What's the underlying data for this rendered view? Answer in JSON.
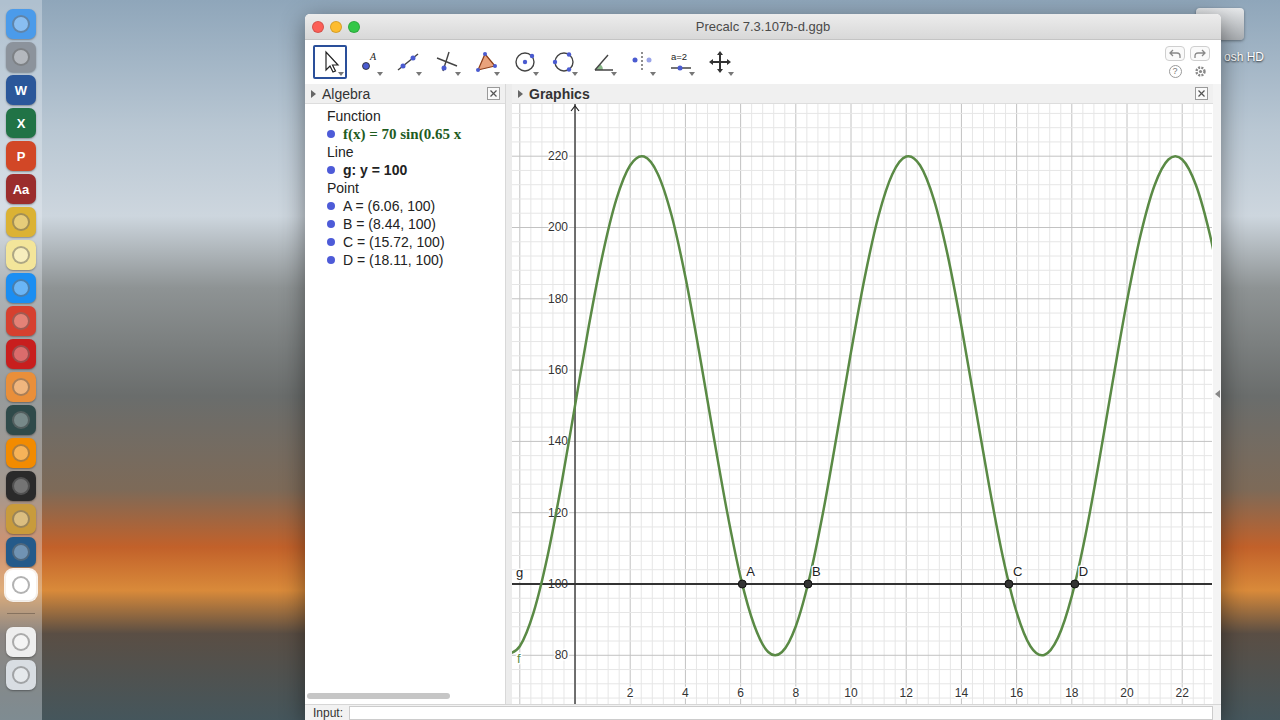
{
  "desktop": {
    "disk_label": "osh HD"
  },
  "dock": {
    "apps": [
      {
        "glyph": "",
        "color": "#4b9bea",
        "selected": false
      },
      {
        "glyph": "",
        "color": "#8c939c",
        "selected": false
      },
      {
        "glyph": "W",
        "color": "#2b579a",
        "selected": false
      },
      {
        "glyph": "X",
        "color": "#217346",
        "selected": false
      },
      {
        "glyph": "P",
        "color": "#d24726",
        "selected": false
      },
      {
        "glyph": "Aa",
        "color": "#9b2d2d",
        "selected": false
      },
      {
        "glyph": "",
        "color": "#dbb234",
        "selected": false
      },
      {
        "glyph": "",
        "color": "#f3e59a",
        "selected": false
      },
      {
        "glyph": "",
        "color": "#1b8ef2",
        "selected": false
      },
      {
        "glyph": "",
        "color": "#d6402f",
        "selected": false
      },
      {
        "glyph": "",
        "color": "#c81e1e",
        "selected": false
      },
      {
        "glyph": "",
        "color": "#e98f3a",
        "selected": false
      },
      {
        "glyph": "",
        "color": "#2f4a4a",
        "selected": false
      },
      {
        "glyph": "",
        "color": "#f28b00",
        "selected": false
      },
      {
        "glyph": "",
        "color": "#2a2a2a",
        "selected": false
      },
      {
        "glyph": "",
        "color": "#c89b3c",
        "selected": false
      },
      {
        "glyph": "",
        "color": "#245a8a",
        "selected": false
      },
      {
        "glyph": "",
        "color": "#ffffff",
        "selected": true
      }
    ],
    "others": [
      {
        "glyph": "",
        "color": "#eeeeee",
        "selected": false
      },
      {
        "glyph": "",
        "color": "#d8dde2",
        "selected": false
      }
    ]
  },
  "window": {
    "title": "Precalc 7.3.107b-d.ggb"
  },
  "toolbar": {
    "tools": [
      {
        "kind": "move",
        "label": "",
        "selected": true
      },
      {
        "kind": "point",
        "label": "A",
        "selected": false
      },
      {
        "kind": "line",
        "label": "",
        "selected": false
      },
      {
        "kind": "perpendicular",
        "label": "",
        "selected": false
      },
      {
        "kind": "polygon",
        "label": "",
        "selected": false
      },
      {
        "kind": "circle",
        "label": "",
        "selected": false
      },
      {
        "kind": "conic",
        "label": "",
        "selected": false
      },
      {
        "kind": "angle",
        "label": "",
        "selected": false
      },
      {
        "kind": "reflect",
        "label": "",
        "selected": false
      },
      {
        "kind": "slider",
        "label": "a=2",
        "selected": false
      },
      {
        "kind": "transform",
        "label": "",
        "selected": false
      }
    ],
    "help_glyph": "?"
  },
  "algebra": {
    "title": "Algebra",
    "groups": [
      {
        "label": "Function",
        "items": [
          {
            "kind": "function",
            "text": "f(x) = 70 sin(0.65 x"
          }
        ]
      },
      {
        "label": "Line",
        "items": [
          {
            "kind": "equation",
            "text": "g: y = 100"
          }
        ]
      },
      {
        "label": "Point",
        "items": [
          {
            "kind": "point",
            "text": "A = (6.06, 100)"
          },
          {
            "kind": "point",
            "text": "B = (8.44, 100)"
          },
          {
            "kind": "point",
            "text": "C = (15.72, 100)"
          },
          {
            "kind": "point",
            "text": "D = (18.11, 100)"
          }
        ]
      }
    ]
  },
  "graphics": {
    "title": "Graphics",
    "x_ticks": [
      "2",
      "4",
      "6",
      "8",
      "10",
      "12",
      "14",
      "16",
      "18",
      "20",
      "22"
    ],
    "y_ticks": [
      "80",
      "100",
      "120",
      "140",
      "160",
      "180",
      "200",
      "220"
    ],
    "series": [
      {
        "label": "f",
        "color": "#5a8a45",
        "x_start": -2.5,
        "x_step": 0.5,
        "values": [
          80.1,
          82.55,
          92.06,
          107.64,
          127.65,
          150,
          172.35,
          192.36,
          207.94,
          217.45,
          219.9,
          215.03,
          203.35,
          186.09,
          164.99,
          142.43,
          120.65,
          101.85,
          88.29,
          80.93,
          80.92,
          88.16,
          101.87,
          120.61,
          142.44,
          165.06,
          186.1,
          203.36,
          215.02,
          219.9,
          217.45,
          207.89,
          192.32,
          172.28,
          149.99,
          127.75,
          107.65,
          92.1,
          82.55,
          80.1,
          84.96,
          96.59,
          113.88,
          134.95,
          157.6,
          179.41,
          198.16,
          211.85,
          219.08,
          219.08,
          211.84,
          198.1,
          179.38
        ]
      }
    ],
    "line": {
      "label": "g",
      "value": 100
    },
    "points": [
      {
        "label": "A",
        "x": 6.06,
        "y": 100
      },
      {
        "label": "B",
        "x": 8.44,
        "y": 100
      },
      {
        "label": "C",
        "x": 15.72,
        "y": 100
      },
      {
        "label": "D",
        "x": 18.11,
        "y": 100
      }
    ]
  },
  "input": {
    "label": "Input:"
  }
}
